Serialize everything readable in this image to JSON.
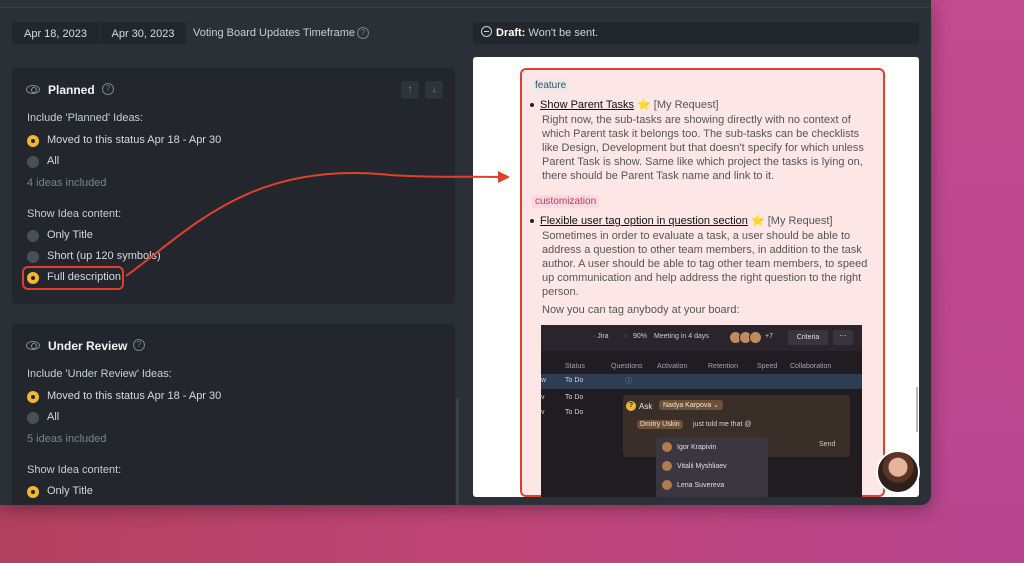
{
  "timeframe": {
    "start_date": "Apr 18, 2023",
    "end_date": "Apr 30, 2023",
    "label": "Voting Board Updates Timeframe",
    "help_glyph": "?"
  },
  "draft": {
    "prefix": "Draft:",
    "text": "Won't be sent."
  },
  "planned": {
    "title": "Planned",
    "include_label": "Include 'Planned' Ideas:",
    "options": [
      "Moved to this status Apr 18 - Apr 30",
      "All"
    ],
    "selected_option": 0,
    "count": "4 ideas included",
    "content_label": "Show Idea content:",
    "content_options": [
      "Only Title",
      "Short (up 120 symbols)",
      "Full description"
    ],
    "selected_content": 2,
    "up_glyph": "↑",
    "down_glyph": "↓"
  },
  "under_review": {
    "title": "Under Review",
    "include_label": "Include 'Under Review' Ideas:",
    "options": [
      "Moved to this status Apr 18 - Apr 30",
      "All"
    ],
    "selected_option": 0,
    "count": "5 ideas included",
    "content_label": "Show Idea content:",
    "content_options": [
      "Only Title"
    ],
    "selected_content": 0
  },
  "preview": {
    "ideas": [
      {
        "tag": "feature",
        "title": "Show Parent Tasks",
        "star": "⭐",
        "suffix": "[My Request]",
        "description": "Right now, the sub-tasks are showing directly with no context of which Parent task it belongs too. The sub-tasks can be checklists like Design, Development but that doesn't specify for which unless Parent Task is show. Same like which project the tasks is lying on, there should be Parent Task name and link to it."
      },
      {
        "tag": "customization",
        "title": "Flexible user tag option in question section",
        "star": "⭐",
        "suffix": "[My Request]",
        "description": "Sometimes in order to evaluate a task, a user should be able to address a question to other team members, in addition to the task author. A user should be able to tag other team members, to speed up communication and help address the right question to the right person.",
        "extra": "Now you can tag anybody at your board:"
      }
    ],
    "screenshot": {
      "jira": "· Jira",
      "progress": "90%",
      "meeting": "Meeting in 4 days",
      "avatars_more": "+7",
      "criteria": "Criteria",
      "more": "···",
      "columns": [
        "Status",
        "Questions",
        "Activation",
        "Retention",
        "Speed",
        "Collaboration"
      ],
      "row_marks": [
        "w",
        "v",
        "v"
      ],
      "rows": [
        "To Do",
        "To Do",
        "To Do"
      ],
      "ask_label": "Ask",
      "ask_person": "Nadya Karpova",
      "mention": "Dmitry Uskin",
      "message": "just told me that @",
      "send": "Send",
      "dropdown": [
        "Igor Krapivin",
        "Vitalii Myshliaev",
        "Lena Suvereva"
      ]
    }
  },
  "colors": {
    "accent": "#f2b630",
    "highlight": "#e0402a",
    "panel": "#23272d",
    "app_bg": "#2b3037"
  }
}
